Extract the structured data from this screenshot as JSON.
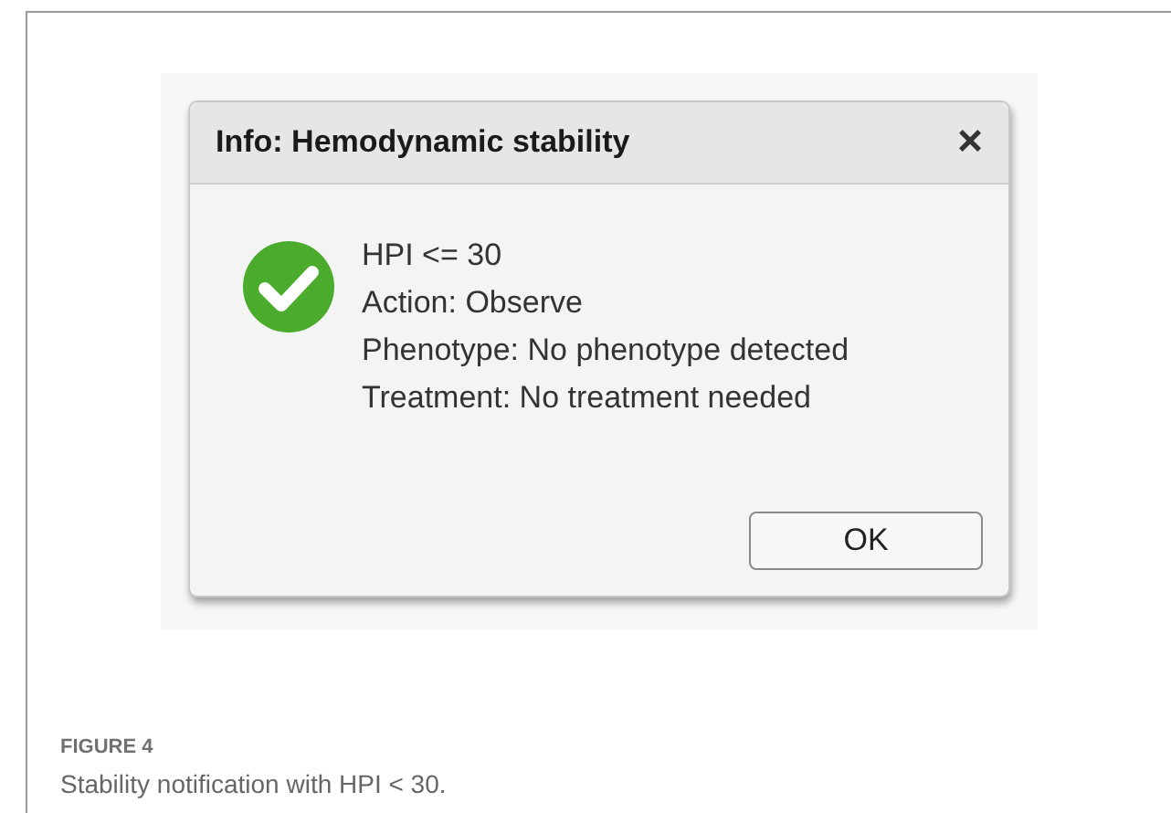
{
  "dialog": {
    "title": "Info: Hemodynamic stability",
    "close": "×",
    "lines": [
      "HPI <= 30",
      "Action: Observe",
      "Phenotype: No phenotype detected",
      "Treatment: No treatment needed"
    ],
    "buttons": [
      "OK"
    ]
  },
  "figure": {
    "label": "FIGURE 4",
    "caption": "Stability notification with HPI < 30."
  }
}
